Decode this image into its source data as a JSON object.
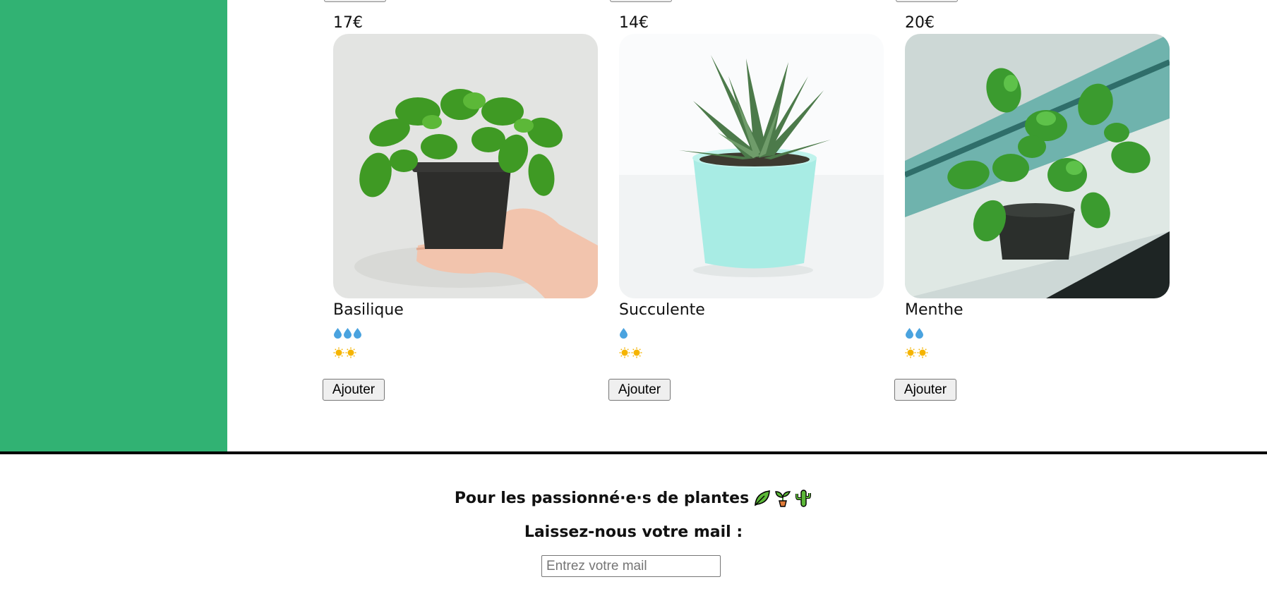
{
  "products": [
    {
      "price": "17€",
      "name": "Basilique",
      "water": 3,
      "light": 2,
      "add_label": "Ajouter",
      "image": "basil-photo"
    },
    {
      "price": "14€",
      "name": "Succulente",
      "water": 1,
      "light": 2,
      "add_label": "Ajouter",
      "image": "succulent-photo"
    },
    {
      "price": "20€",
      "name": "Menthe",
      "water": 2,
      "light": 2,
      "add_label": "Ajouter",
      "image": "mint-photo"
    }
  ],
  "footer": {
    "title": "Pour les passionné·e·s de plantes",
    "icons": [
      "leaf-icon",
      "seedling-icon",
      "cactus-icon"
    ],
    "mail_label": "Laissez-nous votre mail :",
    "mail_placeholder": "Entrez votre mail",
    "mail_value": ""
  },
  "colors": {
    "sidebar": "#31b273",
    "water": "#4aa3df",
    "sun": "#f5b400"
  }
}
